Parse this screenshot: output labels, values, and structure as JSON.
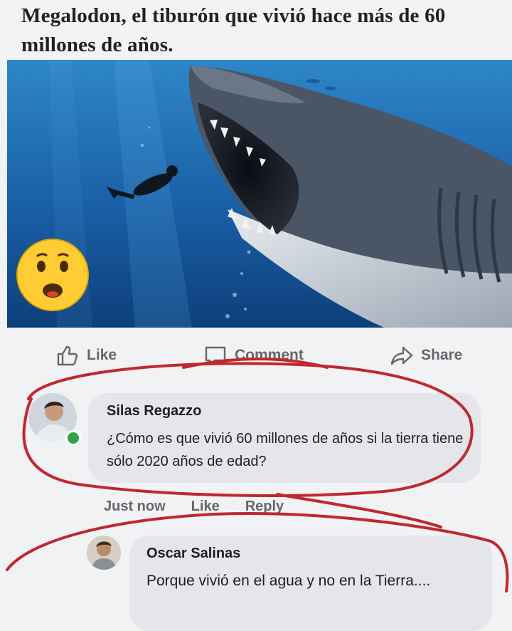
{
  "post": {
    "headline": "Megalodon, el tiburón que vivió hace más de 60 millones de años."
  },
  "reaction": {
    "icon": "astonished-face-emoji"
  },
  "actions": [
    {
      "icon": "thumbs-up-icon",
      "label": "Like"
    },
    {
      "icon": "comment-icon",
      "label": "Comment"
    },
    {
      "icon": "share-icon",
      "label": "Share"
    }
  ],
  "comments": [
    {
      "author": "Silas Regazzo",
      "text": "¿Cómo es que vivió 60 millones de años si la tierra tiene sólo 2020 años de edad?",
      "time": "Just now",
      "like": "Like",
      "reply": "Reply"
    },
    {
      "author": "Oscar Salinas",
      "text": "Porque vivió en el agua y no en la Tierra...."
    }
  ],
  "colors": {
    "ocean": "#1c5fa7",
    "annotation": "#c0282d",
    "comment_bubble": "#e4e6eb",
    "online_dot": "#31a24c"
  }
}
